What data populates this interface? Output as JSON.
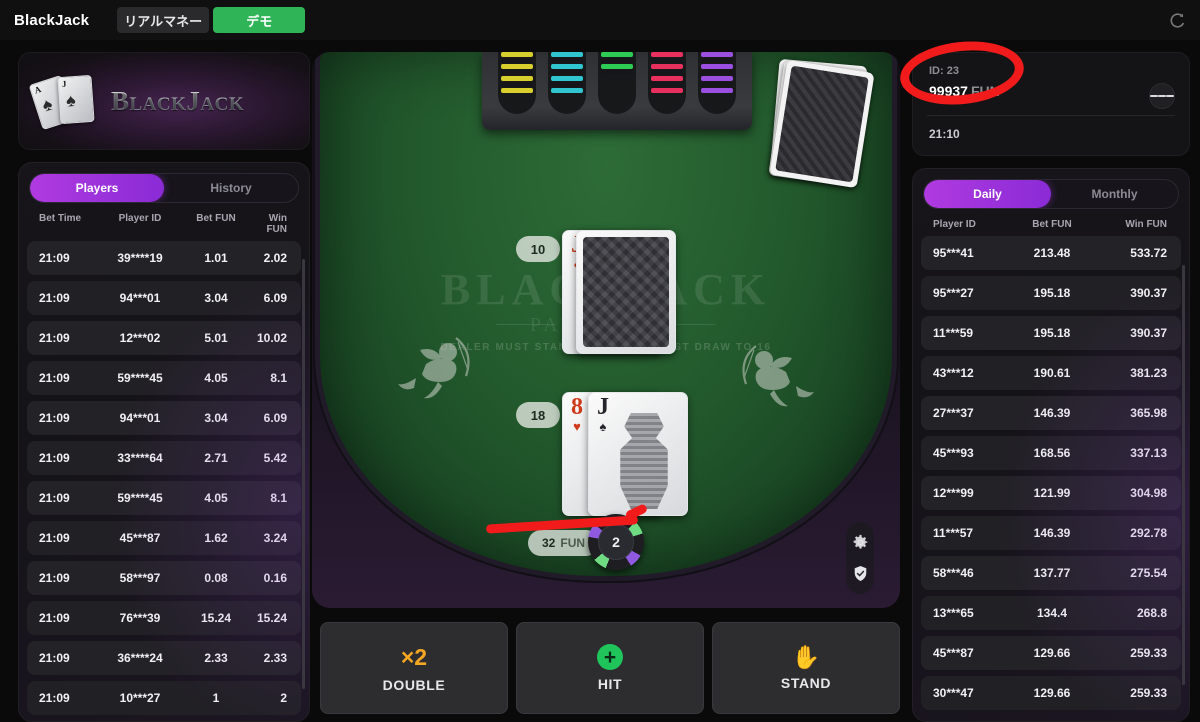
{
  "header": {
    "title": "BlackJack",
    "mode_tabs": [
      {
        "label": "リアルマネー",
        "active": false
      },
      {
        "label": "デモ",
        "active": true
      }
    ],
    "refresh_icon": "refresh-icon"
  },
  "logo": {
    "word": "BlackJack",
    "card1_rank": "A",
    "card1_suit": "♠",
    "card2_rank": "J",
    "card2_suit": "♠"
  },
  "left_panel": {
    "tabs": [
      {
        "label": "Players",
        "active": true
      },
      {
        "label": "History",
        "active": false
      }
    ],
    "columns": [
      "Bet Time",
      "Player ID",
      "Bet FUN",
      "Win FUN"
    ],
    "rows": [
      {
        "time": "21:09",
        "pid": "39****19",
        "bet": "1.01",
        "win": "2.02"
      },
      {
        "time": "21:09",
        "pid": "94***01",
        "bet": "3.04",
        "win": "6.09"
      },
      {
        "time": "21:09",
        "pid": "12***02",
        "bet": "5.01",
        "win": "10.02"
      },
      {
        "time": "21:09",
        "pid": "59****45",
        "bet": "4.05",
        "win": "8.1"
      },
      {
        "time": "21:09",
        "pid": "94***01",
        "bet": "3.04",
        "win": "6.09"
      },
      {
        "time": "21:09",
        "pid": "33****64",
        "bet": "2.71",
        "win": "5.42"
      },
      {
        "time": "21:09",
        "pid": "59****45",
        "bet": "4.05",
        "win": "8.1"
      },
      {
        "time": "21:09",
        "pid": "45***87",
        "bet": "1.62",
        "win": "3.24"
      },
      {
        "time": "21:09",
        "pid": "58***97",
        "bet": "0.08",
        "win": "0.16"
      },
      {
        "time": "21:09",
        "pid": "76***39",
        "bet": "15.24",
        "win": "15.24"
      },
      {
        "time": "21:09",
        "pid": "36****24",
        "bet": "2.33",
        "win": "2.33"
      },
      {
        "time": "21:09",
        "pid": "10***27",
        "bet": "1",
        "win": "2"
      }
    ]
  },
  "account": {
    "id_label": "ID: 23",
    "balance": "99937",
    "currency": "FUN",
    "time": "21:10",
    "menu_icon": "hamburger-icon"
  },
  "right_panel": {
    "tabs": [
      {
        "label": "Daily",
        "active": true
      },
      {
        "label": "Monthly",
        "active": false
      }
    ],
    "columns": [
      "Player ID",
      "Bet FUN",
      "Win FUN"
    ],
    "rows": [
      {
        "pid": "95***41",
        "bet": "213.48",
        "win": "533.72"
      },
      {
        "pid": "95***27",
        "bet": "195.18",
        "win": "390.37"
      },
      {
        "pid": "11***59",
        "bet": "195.18",
        "win": "390.37"
      },
      {
        "pid": "43***12",
        "bet": "190.61",
        "win": "381.23"
      },
      {
        "pid": "27***37",
        "bet": "146.39",
        "win": "365.98"
      },
      {
        "pid": "45***93",
        "bet": "168.56",
        "win": "337.13"
      },
      {
        "pid": "12***99",
        "bet": "121.99",
        "win": "304.98"
      },
      {
        "pid": "11***57",
        "bet": "146.39",
        "win": "292.78"
      },
      {
        "pid": "58***46",
        "bet": "137.77",
        "win": "275.54"
      },
      {
        "pid": "13***65",
        "bet": "134.4",
        "win": "268.8"
      },
      {
        "pid": "45***87",
        "bet": "129.66",
        "win": "259.33"
      },
      {
        "pid": "30***47",
        "bet": "129.66",
        "win": "259.33"
      }
    ]
  },
  "table": {
    "felt_word": "BLACKJACK",
    "felt_pays": "PAYS 3 TO 2",
    "felt_rule": "DEALER MUST STAND TO 17, AND MUST DRAW TO 16",
    "dealer": {
      "score": "10",
      "cards": [
        {
          "rank": "J",
          "suit": "♦",
          "color": "red",
          "face_down": false
        },
        {
          "rank": "",
          "suit": "",
          "color": "",
          "face_down": true
        }
      ]
    },
    "player": {
      "score": "18",
      "cards": [
        {
          "rank": "8",
          "suit": "♥",
          "color": "red",
          "face_down": false
        },
        {
          "rank": "J",
          "suit": "♠",
          "color": "black",
          "face_down": false
        }
      ]
    },
    "bet": {
      "amount": "32",
      "currency": "FUN",
      "chip_value": "2"
    },
    "chip_tray_colors": [
      "#d8cf2e",
      "#31c6cf",
      "#2ecc55",
      "#e8305f",
      "#9b4fe0"
    ],
    "tools": [
      "gear-icon",
      "shield-check-icon"
    ],
    "deck_icon": "card-deck-icon",
    "decor": [
      "cherub-left-icon",
      "cherub-right-icon"
    ]
  },
  "actions": [
    {
      "name": "double",
      "icon": "x2",
      "icon_text": "×2",
      "label": "DOUBLE"
    },
    {
      "name": "hit",
      "icon": "plus",
      "icon_text": "+",
      "label": "HIT"
    },
    {
      "name": "stand",
      "icon": "hand",
      "icon_text": "✋",
      "label": "STAND"
    }
  ],
  "annotations": {
    "circle_target": "balance-highlight",
    "line_target": "bet-area-underline",
    "color": "#f21b1b"
  },
  "colors": {
    "accent_purple": "#a32fdc",
    "demo_green": "#2fb457",
    "felt_green": "#235a2d",
    "double_orange": "#f5a623",
    "hit_green": "#1fc45b",
    "stand_orange": "#f0562d"
  }
}
